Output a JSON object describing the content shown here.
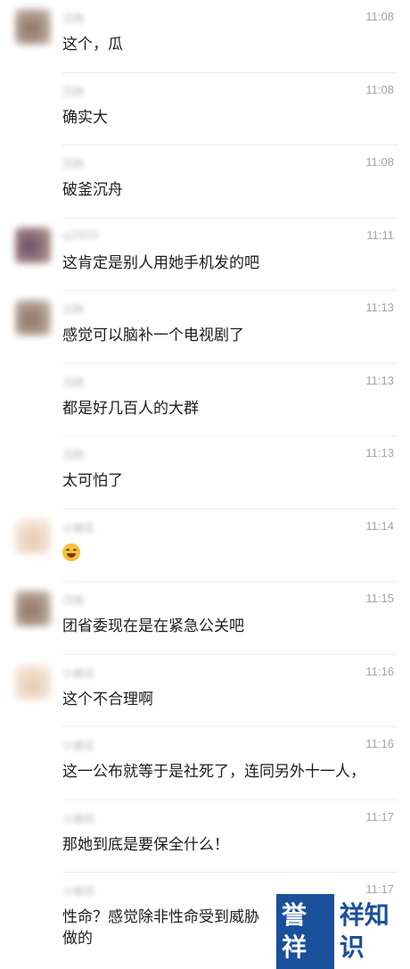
{
  "messages": [
    {
      "name": "沉杨",
      "time": "11:08",
      "text": "这个，瓜",
      "avatar": "a1"
    },
    {
      "name": "沉杨",
      "time": "11:08",
      "text": "确实大",
      "avatar": ""
    },
    {
      "name": "沉杨",
      "time": "11:08",
      "text": "破釜沉舟",
      "avatar": ""
    },
    {
      "name": "sj2020",
      "time": "11:11",
      "text": "这肯定是别人用她手机发的吧",
      "avatar": "a2"
    },
    {
      "name": "沉杨",
      "time": "11:13",
      "text": "感觉可以脑补一个电视剧了",
      "avatar": "a1"
    },
    {
      "name": "沉杨",
      "time": "11:13",
      "text": "都是好几百人的大群",
      "avatar": ""
    },
    {
      "name": "沉杨",
      "time": "11:13",
      "text": "太可怕了",
      "avatar": ""
    },
    {
      "name": "小楼花",
      "time": "11:14",
      "text": "",
      "emoji": "grin-sweat-emoji",
      "avatar": "a3"
    },
    {
      "name": "沉杨",
      "time": "11:15",
      "text": "团省委现在是在紧急公关吧",
      "avatar": "a1"
    },
    {
      "name": "小楼花",
      "time": "11:16",
      "text": "这个不合理啊",
      "avatar": "a3"
    },
    {
      "name": "小楼花",
      "time": "11:16",
      "text": "这一公布就等于是社死了，连同另外十一人，",
      "avatar": ""
    },
    {
      "name": "小楼花",
      "time": "11:17",
      "text": "那她到底是要保全什么！",
      "avatar": ""
    },
    {
      "name": "小楼花",
      "time": "11:17",
      "text": "性命？感觉除非性命受到威胁",
      "text2": "做的",
      "avatar": ""
    }
  ],
  "watermark": {
    "box": "誉祥",
    "text": "祥知识"
  },
  "colors": {
    "time": "#a3a3a3",
    "text": "#1c1c1c",
    "divider": "#ececec",
    "watermark": "#1a4f9c"
  }
}
